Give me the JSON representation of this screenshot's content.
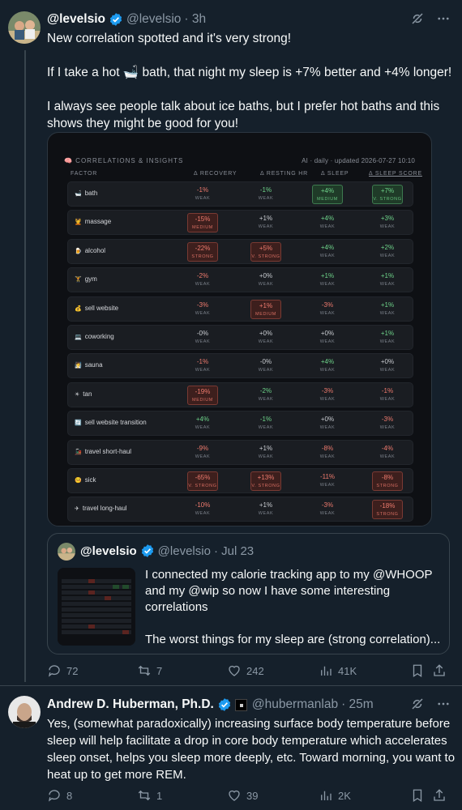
{
  "tweet1": {
    "name": "@levelsio",
    "handle": "@levelsio",
    "time": "· 3h",
    "text": [
      "New correlation spotted and it's very strong!",
      "If I take a hot 🛁 bath, that night my sleep is +7% better and +4% longer!",
      "I always see people talk about ice baths, but I prefer hot baths and this shows they might be good for you!"
    ],
    "card": {
      "title": "🧠 CORRELATIONS & INSIGHTS",
      "meta": "AI · daily · updated 2026-07-27 10:10",
      "headers": [
        "FACTOR",
        "Δ RECOVERY",
        "Δ RESTING HR",
        "Δ SLEEP",
        "Δ SLEEP SCORE"
      ],
      "rows": [
        {
          "icon": "🛁",
          "factor": "bath",
          "cells": [
            {
              "v": "-1%",
              "s": "WEAK",
              "c": "neg",
              "h": false
            },
            {
              "v": "-1%",
              "s": "WEAK",
              "c": "pos",
              "h": false
            },
            {
              "v": "+4%",
              "s": "MEDIUM",
              "c": "pos",
              "h": true
            },
            {
              "v": "+7%",
              "s": "V. STRONG",
              "c": "pos",
              "h": true
            }
          ]
        },
        {
          "icon": "💆",
          "factor": "massage",
          "cells": [
            {
              "v": "-15%",
              "s": "MEDIUM",
              "c": "neg",
              "h": true
            },
            {
              "v": "+1%",
              "s": "WEAK",
              "c": "neu",
              "h": false
            },
            {
              "v": "+4%",
              "s": "WEAK",
              "c": "pos",
              "h": false
            },
            {
              "v": "+3%",
              "s": "WEAK",
              "c": "pos",
              "h": false
            }
          ]
        },
        {
          "icon": "🍺",
          "factor": "alcohol",
          "cells": [
            {
              "v": "-22%",
              "s": "STRONG",
              "c": "neg",
              "h": true
            },
            {
              "v": "+5%",
              "s": "V. STRONG",
              "c": "neg",
              "h": true
            },
            {
              "v": "+4%",
              "s": "WEAK",
              "c": "pos",
              "h": false
            },
            {
              "v": "+2%",
              "s": "WEAK",
              "c": "pos",
              "h": false
            }
          ]
        },
        {
          "icon": "🏋",
          "factor": "gym",
          "cells": [
            {
              "v": "-2%",
              "s": "WEAK",
              "c": "neg",
              "h": false
            },
            {
              "v": "+0%",
              "s": "WEAK",
              "c": "neu",
              "h": false
            },
            {
              "v": "+1%",
              "s": "WEAK",
              "c": "pos",
              "h": false
            },
            {
              "v": "+1%",
              "s": "WEAK",
              "c": "pos",
              "h": false
            }
          ]
        },
        {
          "icon": "💰",
          "factor": "sell website",
          "cells": [
            {
              "v": "-3%",
              "s": "WEAK",
              "c": "neg",
              "h": false
            },
            {
              "v": "+1%",
              "s": "MEDIUM",
              "c": "neg",
              "h": true
            },
            {
              "v": "-3%",
              "s": "WEAK",
              "c": "neg",
              "h": false
            },
            {
              "v": "+1%",
              "s": "WEAK",
              "c": "pos",
              "h": false
            }
          ]
        },
        {
          "icon": "💻",
          "factor": "coworking",
          "cells": [
            {
              "v": "-0%",
              "s": "WEAK",
              "c": "neu",
              "h": false
            },
            {
              "v": "+0%",
              "s": "WEAK",
              "c": "neu",
              "h": false
            },
            {
              "v": "+0%",
              "s": "WEAK",
              "c": "neu",
              "h": false
            },
            {
              "v": "+1%",
              "s": "WEAK",
              "c": "pos",
              "h": false
            }
          ]
        },
        {
          "icon": "🧖",
          "factor": "sauna",
          "cells": [
            {
              "v": "-1%",
              "s": "WEAK",
              "c": "neg",
              "h": false
            },
            {
              "v": "-0%",
              "s": "WEAK",
              "c": "neu",
              "h": false
            },
            {
              "v": "+4%",
              "s": "WEAK",
              "c": "pos",
              "h": false
            },
            {
              "v": "+0%",
              "s": "WEAK",
              "c": "neu",
              "h": false
            }
          ]
        },
        {
          "icon": "☀",
          "factor": "tan",
          "cells": [
            {
              "v": "-19%",
              "s": "MEDIUM",
              "c": "neg",
              "h": true
            },
            {
              "v": "-2%",
              "s": "WEAK",
              "c": "pos",
              "h": false
            },
            {
              "v": "-3%",
              "s": "WEAK",
              "c": "neg",
              "h": false
            },
            {
              "v": "-1%",
              "s": "WEAK",
              "c": "neg",
              "h": false
            }
          ]
        },
        {
          "icon": "🔄",
          "factor": "sell website transition",
          "cells": [
            {
              "v": "+4%",
              "s": "WEAK",
              "c": "pos",
              "h": false
            },
            {
              "v": "-1%",
              "s": "WEAK",
              "c": "pos",
              "h": false
            },
            {
              "v": "+0%",
              "s": "WEAK",
              "c": "neu",
              "h": false
            },
            {
              "v": "-3%",
              "s": "WEAK",
              "c": "neg",
              "h": false
            }
          ]
        },
        {
          "icon": "🚂",
          "factor": "travel short-haul",
          "cells": [
            {
              "v": "-9%",
              "s": "WEAK",
              "c": "neg",
              "h": false
            },
            {
              "v": "+1%",
              "s": "WEAK",
              "c": "neu",
              "h": false
            },
            {
              "v": "-8%",
              "s": "WEAK",
              "c": "neg",
              "h": false
            },
            {
              "v": "-4%",
              "s": "WEAK",
              "c": "neg",
              "h": false
            }
          ]
        },
        {
          "icon": "🤒",
          "factor": "sick",
          "cells": [
            {
              "v": "-65%",
              "s": "V. STRONG",
              "c": "neg",
              "h": true
            },
            {
              "v": "+13%",
              "s": "V. STRONG",
              "c": "neg",
              "h": true
            },
            {
              "v": "-11%",
              "s": "WEAK",
              "c": "neg",
              "h": false
            },
            {
              "v": "-8%",
              "s": "STRONG",
              "c": "neg",
              "h": true
            }
          ]
        },
        {
          "icon": "✈",
          "factor": "travel long-haul",
          "cells": [
            {
              "v": "-10%",
              "s": "WEAK",
              "c": "neg",
              "h": false
            },
            {
              "v": "+1%",
              "s": "WEAK",
              "c": "neu",
              "h": false
            },
            {
              "v": "-3%",
              "s": "WEAK",
              "c": "neg",
              "h": false
            },
            {
              "v": "-18%",
              "s": "STRONG",
              "c": "neg",
              "h": true
            }
          ]
        }
      ]
    },
    "quote": {
      "name": "@levelsio",
      "handle": "@levelsio",
      "time": "· Jul 23",
      "text": [
        "I connected my calorie tracking app to my @WHOOP and my @wip so now I have some interesting correlations",
        "The worst things for my sleep are (strong correlation)..."
      ]
    },
    "actions": {
      "replies": "72",
      "reposts": "7",
      "likes": "242",
      "views": "41K"
    }
  },
  "tweet2": {
    "name": "Andrew D. Huberman, Ph.D.",
    "handle": "@hubermanlab",
    "time": "· 25m",
    "text": "Yes, (somewhat paradoxically) increasing surface body temperature before sleep will help facilitate a drop in core body temperature which accelerates sleep onset, helps you sleep more deeply, etc. Toward morning, you want to heat up to get more REM.",
    "actions": {
      "replies": "8",
      "reposts": "1",
      "likes": "39",
      "views": "2K"
    }
  },
  "colors": {
    "bg": "#15202b",
    "accent": "#1d9bf0",
    "muted": "#8b98a5"
  }
}
